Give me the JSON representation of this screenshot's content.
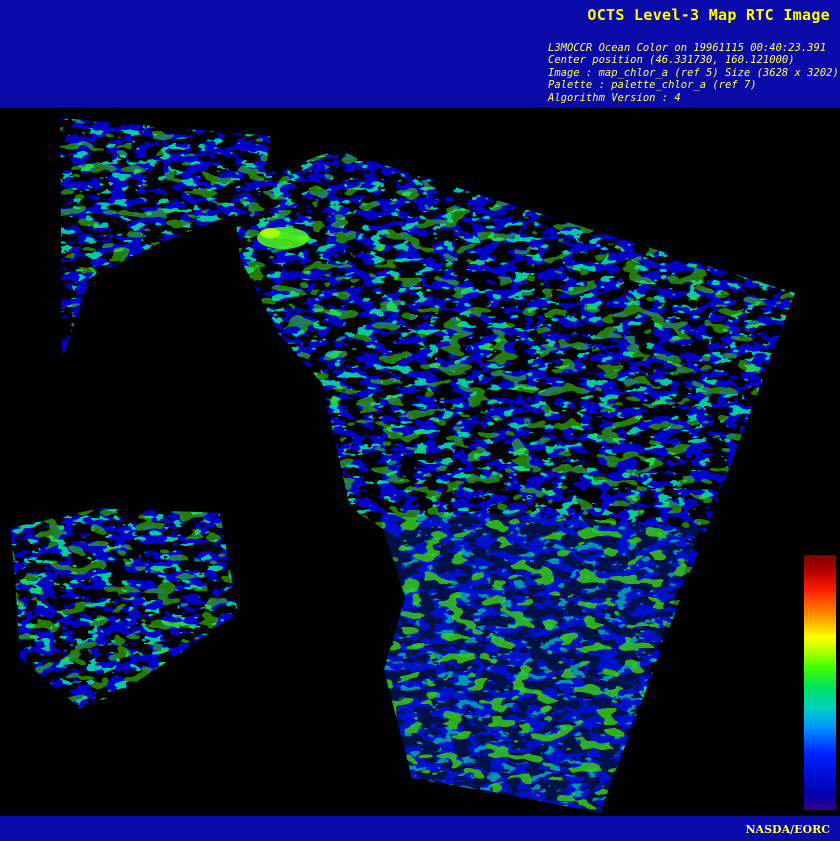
{
  "header": {
    "title": "OCTS Level-3 Map RTC Image",
    "metadata_lines": [
      "L3MOCCR Ocean Color on 19961115 00:40:23.391",
      "Center position (46.331730, 160.121000)",
      "Image : map_chlor_a (ref 5) Size (3628 x 3202)",
      "Palette : palette_chlor_a (ref 7)",
      "Algorithm Version : 4"
    ]
  },
  "footer": {
    "credit": "NASDA/EORC"
  },
  "colors": {
    "banner": "#0a0aa8",
    "title_text": "#ffff00",
    "background": "#000000",
    "data_low": "#0000c8",
    "data_mid": "#00b4ff",
    "data_high": "#3cff00"
  },
  "legend": {
    "palette": "chlor_a",
    "orientation": "vertical",
    "low_color": "#3a0088",
    "high_color": "#800000"
  }
}
